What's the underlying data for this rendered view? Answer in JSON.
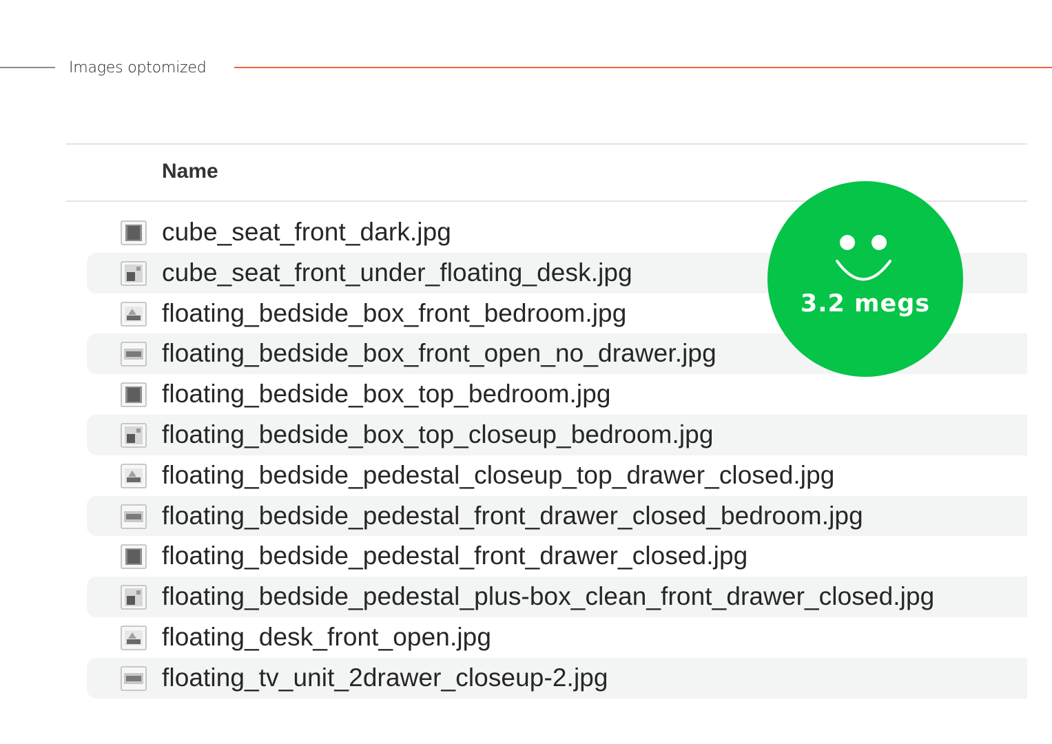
{
  "header": {
    "label": "Images optomized"
  },
  "colors": {
    "accent_rule": "#f0613e",
    "badge_green": "#05c447",
    "row_alt": "#f3f4f4"
  },
  "browser": {
    "column_name": "Name",
    "files": [
      {
        "name": "cube_seat_front_dark.jpg",
        "icon": "image-file-icon"
      },
      {
        "name": "cube_seat_front_under_floating_desk.jpg",
        "icon": "image-file-icon"
      },
      {
        "name": "floating_bedside_box_front_bedroom.jpg",
        "icon": "image-file-icon"
      },
      {
        "name": "floating_bedside_box_front_open_no_drawer.jpg",
        "icon": "image-file-icon"
      },
      {
        "name": "floating_bedside_box_top_bedroom.jpg",
        "icon": "image-file-icon"
      },
      {
        "name": "floating_bedside_box_top_closeup_bedroom.jpg",
        "icon": "image-file-icon"
      },
      {
        "name": "floating_bedside_pedestal_closeup_top_drawer_closed.jpg",
        "icon": "image-file-icon"
      },
      {
        "name": "floating_bedside_pedestal_front_drawer_closed_bedroom.jpg",
        "icon": "image-file-icon"
      },
      {
        "name": "floating_bedside_pedestal_front_drawer_closed.jpg",
        "icon": "image-file-icon"
      },
      {
        "name": "floating_bedside_pedestal_plus-box_clean_front_drawer_closed.jpg",
        "icon": "image-file-icon"
      },
      {
        "name": "floating_desk_front_open.jpg",
        "icon": "image-file-icon"
      },
      {
        "name": "floating_tv_unit_2drawer_closeup-2.jpg",
        "icon": "image-file-icon"
      }
    ]
  },
  "badge": {
    "text": "3.2 megs",
    "icon": "smiley-face-icon"
  }
}
